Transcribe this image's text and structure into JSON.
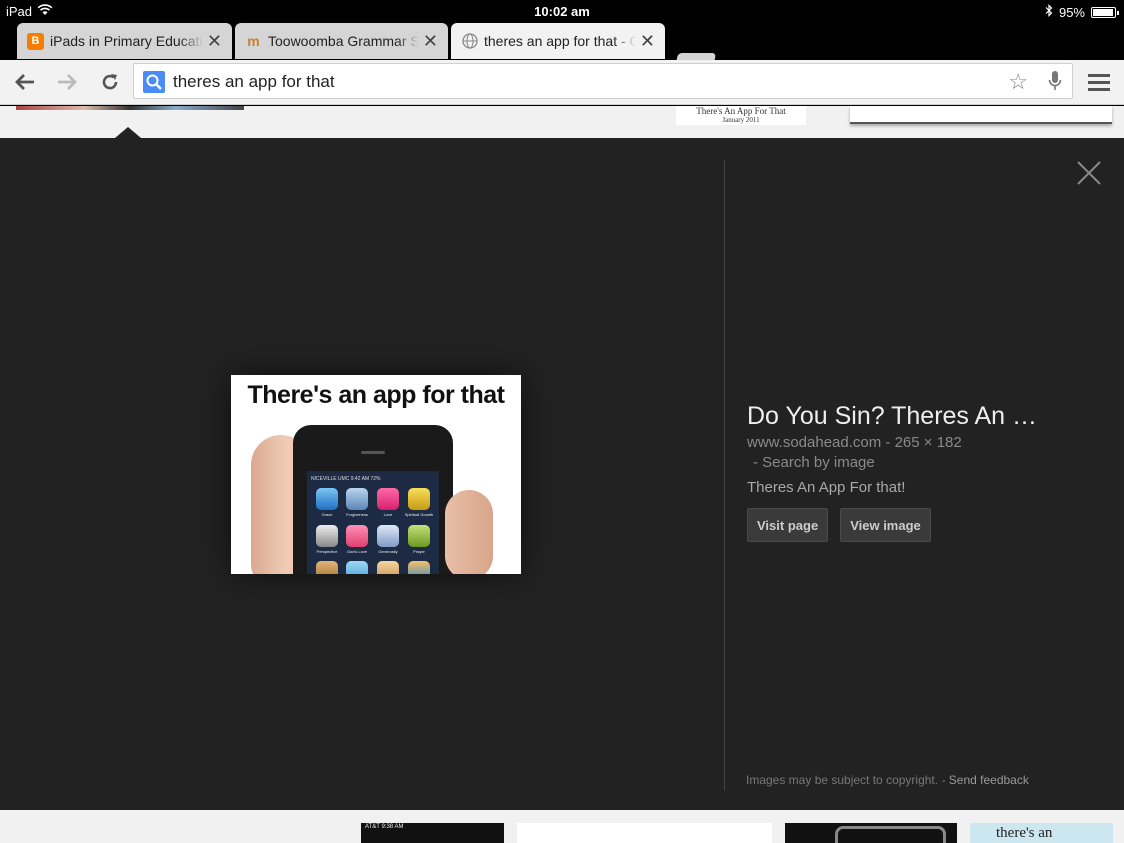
{
  "status_bar": {
    "device": "iPad",
    "time": "10:02 am",
    "battery": "95%",
    "battery_level": 0.95
  },
  "tabs": [
    {
      "title": "iPads in Primary Education",
      "favicon": "blogger-icon",
      "active": false
    },
    {
      "title": "Toowoomba Grammar School",
      "favicon": "moodle-icon",
      "active": false
    },
    {
      "title": "theres an app for that - Google",
      "favicon": "globe-icon",
      "active": true
    }
  ],
  "omnibox": {
    "query": "theres an app for that"
  },
  "image_strip_top": {
    "caption_title": "There's An App For That",
    "caption_date": "January 2011"
  },
  "preview": {
    "image_text": "There's an app for that",
    "phone_status_text": "NICEVILLE UMC   9:42 AM   72%",
    "app_labels": [
      "Grace",
      "Forgiveness",
      "Love",
      "Spiritual Growth",
      "Perspective",
      "God's Love",
      "Generosity",
      "Prayer"
    ],
    "title": "Do You Sin? Theres An …",
    "domain": "www.sodahead.com",
    "dimensions": "265 × 182",
    "search_by_image": "Search by image",
    "description": "Theres An App For that!",
    "visit_page": "Visit page",
    "view_image": "View image",
    "copyright_note": "Images may be subject to copyright.",
    "send_feedback": "Send feedback"
  },
  "image_strip_bottom": {
    "thumb1_status": "AT&T    9:38 AM",
    "thumb4_text": "there's an"
  },
  "colors": {
    "preview_bg": "#222222",
    "omnibox_search": "#4a8bf5",
    "blogger_orange": "#f57d00"
  }
}
